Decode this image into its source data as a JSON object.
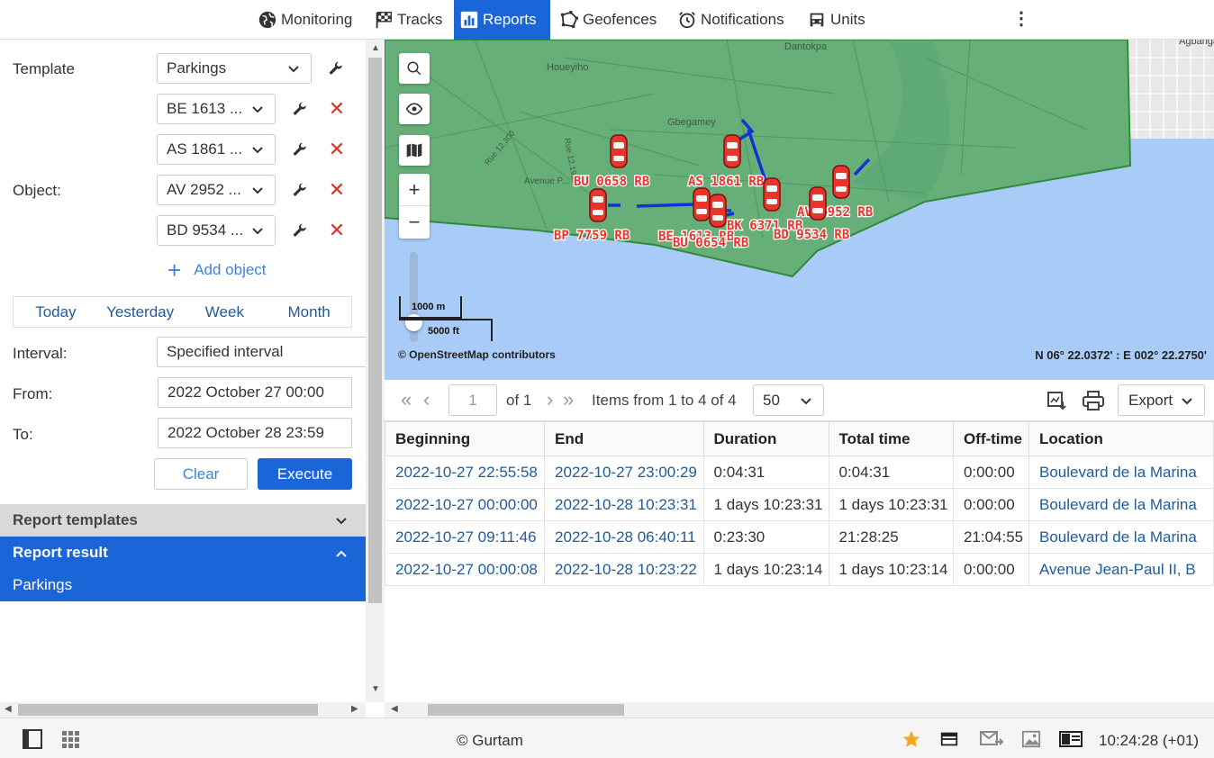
{
  "nav": {
    "items": [
      {
        "label": "Monitoring",
        "icon": "globe-icon"
      },
      {
        "label": "Tracks",
        "icon": "checkered-flag-icon"
      },
      {
        "label": "Reports",
        "icon": "bar-chart-icon"
      },
      {
        "label": "Geofences",
        "icon": "polygon-icon"
      },
      {
        "label": "Notifications",
        "icon": "alarm-clock-icon"
      },
      {
        "label": "Units",
        "icon": "car-icon"
      }
    ],
    "more": "⋮"
  },
  "form": {
    "template_label": "Template",
    "template_value": "Parkings",
    "object_label": "Object:",
    "objects": [
      "BE 1613 ...",
      "AS 1861 ...",
      "AV 2952 ...",
      "BD 9534 ..."
    ],
    "add_object": "Add object",
    "periods": [
      "Today",
      "Yesterday",
      "Week",
      "Month"
    ],
    "interval_label": "Interval:",
    "interval_value": "Specified interval",
    "from_label": "From:",
    "from_value": "2022 October 27 00:00",
    "to_label": "To:",
    "to_value": "2022 October 28 23:59",
    "clear": "Clear",
    "execute": "Execute"
  },
  "accordion": {
    "templates": "Report templates",
    "result": "Report result",
    "parkings": "Parkings"
  },
  "map": {
    "street_labels": [
      "Houeyiho",
      "Gbegamey",
      "Dantokpa",
      "Agbanga",
      "Rue 12.191",
      "Rue 12.300",
      "Avenue P..."
    ],
    "units": [
      "BU 0658 RB",
      "AS 1861 RB",
      "BK 6371 RB",
      "AV 2952 RB",
      "BP 7759 RB",
      "BE 1613 RB",
      "BU 0654 RB",
      "BD 9534 RB"
    ],
    "scale_m": "1000 m",
    "scale_ft": "5000 ft",
    "attribution": "© OpenStreetMap contributors",
    "coords": "N 06° 22.0372' : E 002° 22.2750'",
    "unit_color": "#e8342b",
    "track_color": "#1533d4",
    "zone_color": "#5aaa63"
  },
  "pager": {
    "page": "1",
    "of": "of 1",
    "items": "Items from 1 to 4 of 4",
    "per_page": "50",
    "export": "Export"
  },
  "table": {
    "headers": [
      "Beginning",
      "End",
      "Duration",
      "Total time",
      "Off-time",
      "Location"
    ],
    "rows": [
      [
        "2022-10-27 22:55:58",
        "2022-10-27 23:00:29",
        "0:04:31",
        "0:04:31",
        "0:00:00",
        "Boulevard de la Marina"
      ],
      [
        "2022-10-27 00:00:00",
        "2022-10-28 10:23:31",
        "1 days 10:23:31",
        "1 days 10:23:31",
        "0:00:00",
        "Boulevard de la Marina"
      ],
      [
        "2022-10-27 09:11:46",
        "2022-10-28 06:40:11",
        "0:23:30",
        "21:28:25",
        "21:04:55",
        "Boulevard de la Marina"
      ],
      [
        "2022-10-27 00:00:08",
        "2022-10-28 10:23:22",
        "1 days 10:23:14",
        "1 days 10:23:14",
        "0:00:00",
        "Avenue Jean-Paul II, B"
      ]
    ]
  },
  "footer": {
    "copyright": "© Gurtam",
    "clock": "10:24:28 (+01)",
    "accent": "#1a66d9",
    "star_color": "#f5a623"
  }
}
